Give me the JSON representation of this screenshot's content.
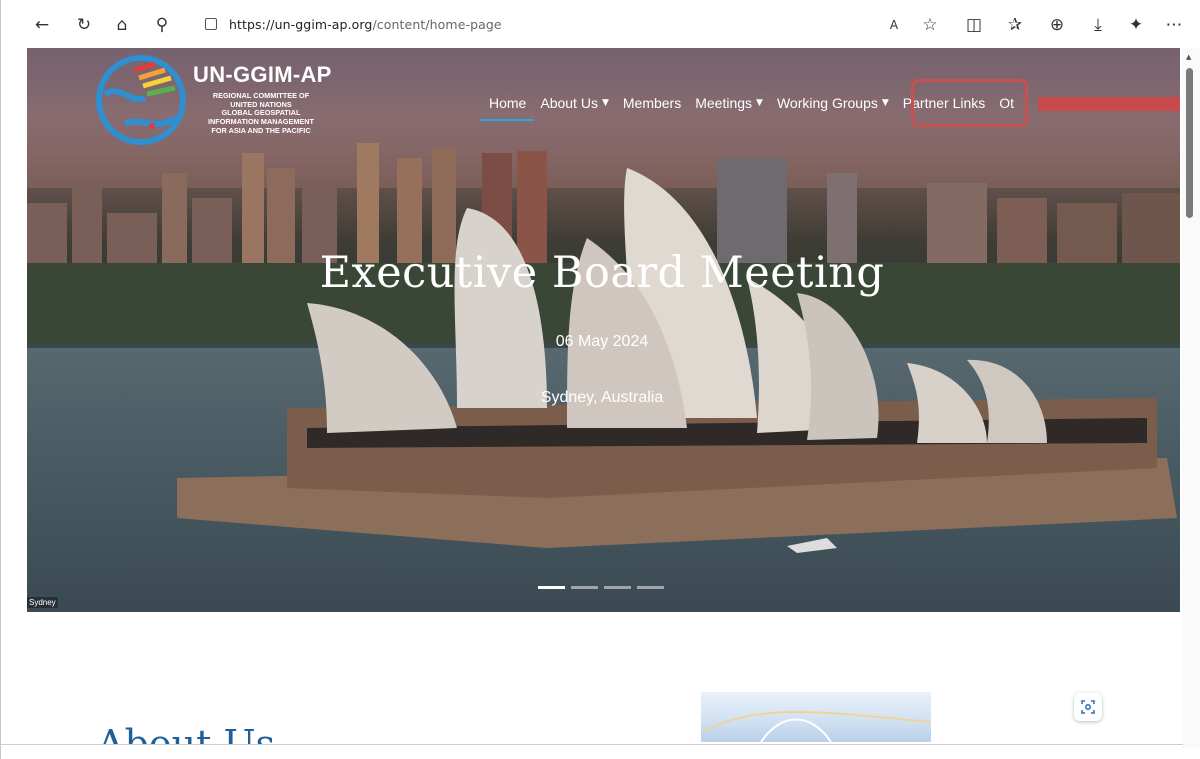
{
  "browser": {
    "url_domain": "https://un-ggim-ap.org",
    "url_path": "/content/home-page",
    "icons": [
      "back-icon",
      "refresh-icon",
      "home-icon",
      "search-icon",
      "read-aloud-icon",
      "favorite-icon",
      "split-screen-icon",
      "favorites-list-icon",
      "collections-icon",
      "downloads-icon",
      "extensions-icon",
      "more-icon"
    ]
  },
  "site": {
    "logo_title": "UN-GGIM-AP",
    "logo_subtitle_lines": [
      "REGIONAL COMMITTEE OF",
      "UNITED NATIONS",
      "GLOBAL GEOSPATIAL",
      "INFORMATION MANAGEMENT",
      "FOR ASIA AND THE PACIFIC"
    ]
  },
  "nav": {
    "home": "Home",
    "about": "About Us",
    "members": "Members",
    "meetings": "Meetings",
    "working_groups": "Working Groups",
    "partner_links": "Partner Links",
    "other": "Ot"
  },
  "hero": {
    "title": "Executive Board Meeting",
    "date": "06 May 2024",
    "location": "Sydney, Australia",
    "caption": "Sydney",
    "slide_count": 4,
    "active_slide": 1
  },
  "content": {
    "about_heading": "About Us"
  },
  "colors": {
    "highlight": "#c85050",
    "nav_active": "#2aa6e0",
    "heading": "#1f5f9a"
  }
}
